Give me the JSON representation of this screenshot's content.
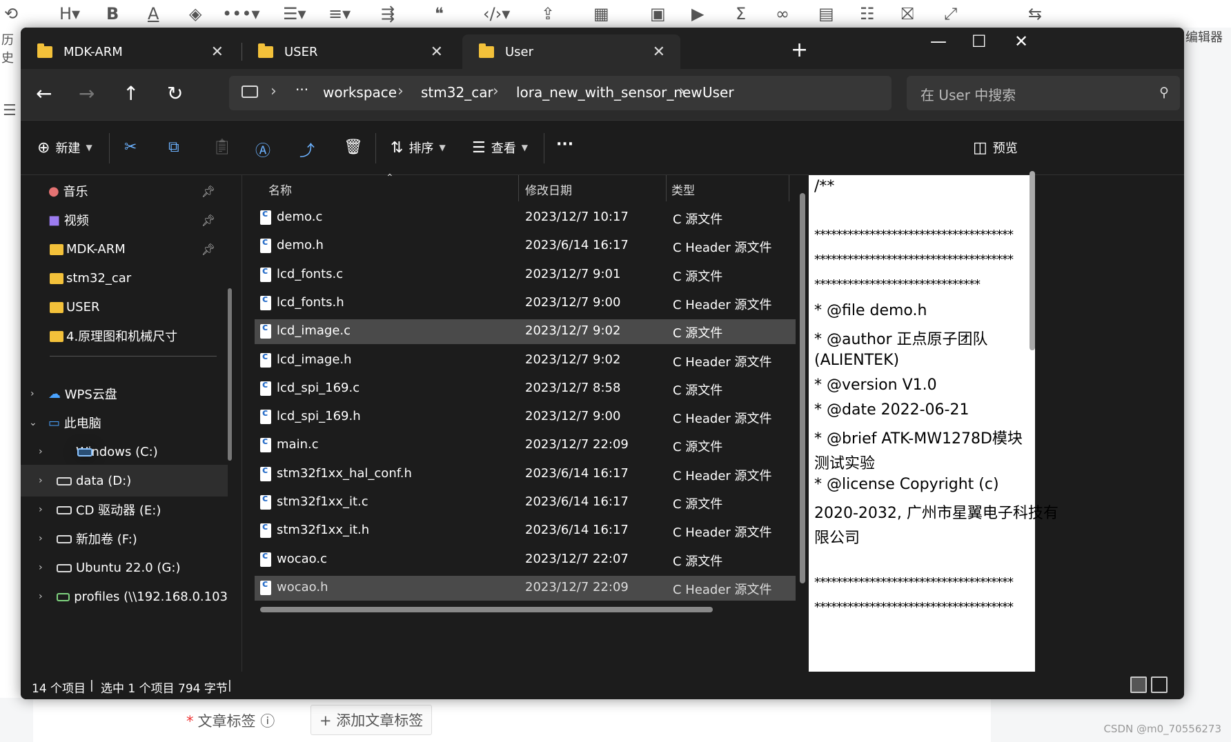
{
  "background": {
    "left_label": "历史",
    "right_label": "编辑器",
    "article_tags_label": "文章标签",
    "add_tag_button": "+ 添加文章标签",
    "watermark": "CSDN @m0_70556273"
  },
  "tabs": [
    {
      "label": "MDK-ARM",
      "active": false
    },
    {
      "label": "USER",
      "active": false
    },
    {
      "label": "User",
      "active": true
    }
  ],
  "address": {
    "crumbs": [
      "workspace",
      "stm32_car",
      "lora_new_with_sensor_new",
      "User"
    ],
    "ellipsis": "···"
  },
  "search": {
    "placeholder": "在 User 中搜索"
  },
  "toolbar": {
    "new_label": "新建",
    "sort_label": "排序",
    "view_label": "查看",
    "more": "···",
    "preview_label": "预览"
  },
  "sidebar": {
    "quick_access": [
      {
        "label": "音乐",
        "pinned": true
      },
      {
        "label": "视频",
        "pinned": true
      },
      {
        "label": "MDK-ARM",
        "pinned": true
      },
      {
        "label": "stm32_car",
        "pinned": false
      },
      {
        "label": "USER",
        "pinned": false
      },
      {
        "label": "4.原理图和机械尺寸",
        "pinned": false
      }
    ],
    "wps": "WPS云盘",
    "this_pc": "此电脑",
    "drives": [
      {
        "label": "Windows (C:)",
        "selected": false
      },
      {
        "label": "data (D:)",
        "selected": true
      },
      {
        "label": "CD 驱动器 (E:)",
        "selected": false
      },
      {
        "label": "新加卷 (F:)",
        "selected": false
      },
      {
        "label": "Ubuntu 22.0 (G:)",
        "selected": false
      },
      {
        "label": "profiles (\\\\192.168.0.103",
        "selected": false
      }
    ]
  },
  "columns": {
    "name": "名称",
    "date": "修改日期",
    "type": "类型"
  },
  "files": [
    {
      "name": "demo.c",
      "date": "2023/12/7 10:17",
      "type": "C 源文件"
    },
    {
      "name": "demo.h",
      "date": "2023/6/14 16:17",
      "type": "C Header 源文件"
    },
    {
      "name": "lcd_fonts.c",
      "date": "2023/12/7 9:01",
      "type": "C 源文件"
    },
    {
      "name": "lcd_fonts.h",
      "date": "2023/12/7 9:00",
      "type": "C Header 源文件"
    },
    {
      "name": "lcd_image.c",
      "date": "2023/12/7 9:02",
      "type": "C 源文件"
    },
    {
      "name": "lcd_image.h",
      "date": "2023/12/7 9:02",
      "type": "C Header 源文件"
    },
    {
      "name": "lcd_spi_169.c",
      "date": "2023/12/7 8:58",
      "type": "C 源文件"
    },
    {
      "name": "lcd_spi_169.h",
      "date": "2023/12/7 9:00",
      "type": "C Header 源文件"
    },
    {
      "name": "main.c",
      "date": "2023/12/7 22:09",
      "type": "C 源文件"
    },
    {
      "name": "stm32f1xx_hal_conf.h",
      "date": "2023/6/14 16:17",
      "type": "C Header 源文件"
    },
    {
      "name": "stm32f1xx_it.c",
      "date": "2023/6/14 16:17",
      "type": "C 源文件"
    },
    {
      "name": "stm32f1xx_it.h",
      "date": "2023/6/14 16:17",
      "type": "C Header 源文件"
    },
    {
      "name": "wocao.c",
      "date": "2023/12/7 22:07",
      "type": "C 源文件"
    },
    {
      "name": "wocao.h",
      "date": "2023/12/7 22:09",
      "type": "C Header 源文件"
    }
  ],
  "preview_lines": [
    "/**",
    "",
    "************************************",
    "************************************",
    "******************************",
    " * @file        demo.h",
    " * @author      正点原子团队",
    "(ALIENTEK)",
    " * @version     V1.0",
    " * @date        2022-06-21",
    " * @brief       ATK-MW1278D模块",
    "测试实验",
    " * @license     Copyright (c)",
    "2020-2032, 广州市星翼电子科技有",
    "限公司",
    "",
    "************************************",
    "************************************"
  ],
  "status": {
    "count": "14 个项目",
    "selection": "选中 1 个项目  794 字节"
  }
}
